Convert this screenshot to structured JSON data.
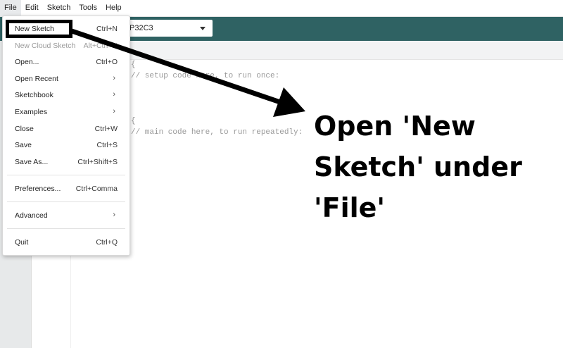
{
  "menubar": {
    "items": [
      "File",
      "Edit",
      "Sketch",
      "Tools",
      "Help"
    ]
  },
  "toolbar": {
    "board_selector": "P32C3"
  },
  "editor": {
    "line1": "{",
    "line2": "// setup code here, to run once:",
    "line4": "{",
    "line5": "// main code here, to run repeatedly:"
  },
  "file_menu": {
    "items": [
      {
        "label": "New Sketch",
        "shortcut": "Ctrl+N"
      },
      {
        "label": "New Cloud Sketch",
        "shortcut": "Alt+Ctrl+N"
      },
      {
        "label": "Open...",
        "shortcut": "Ctrl+O"
      },
      {
        "label": "Open Recent",
        "shortcut": ""
      },
      {
        "label": "Sketchbook",
        "shortcut": ""
      },
      {
        "label": "Examples",
        "shortcut": ""
      },
      {
        "label": "Close",
        "shortcut": "Ctrl+W"
      },
      {
        "label": "Save",
        "shortcut": "Ctrl+S"
      },
      {
        "label": "Save As...",
        "shortcut": "Ctrl+Shift+S"
      },
      {
        "label": "Preferences...",
        "shortcut": "Ctrl+Comma"
      },
      {
        "label": "Advanced",
        "shortcut": ""
      },
      {
        "label": "Quit",
        "shortcut": "Ctrl+Q"
      }
    ]
  },
  "annotation": {
    "line1": "Open 'New",
    "line2": "Sketch' under",
    "line3": "'File'",
    "color": "#000000"
  },
  "colors": {
    "toolbar": "#2f6263",
    "menu_bg": "#ffffff"
  }
}
